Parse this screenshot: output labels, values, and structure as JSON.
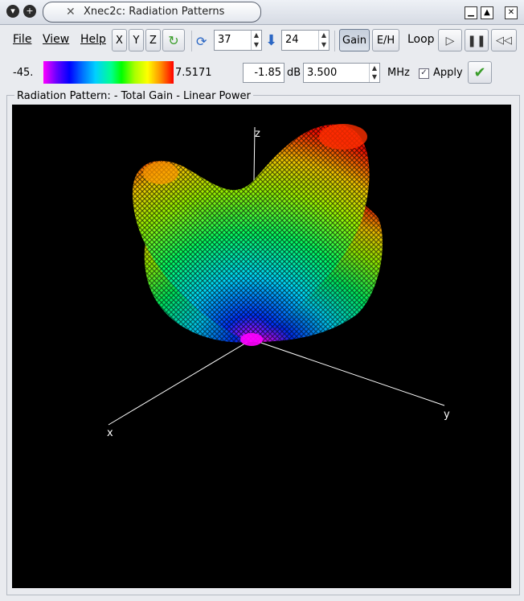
{
  "window": {
    "title": "Xnec2c: Radiation Patterns"
  },
  "menu": [
    "File",
    "View",
    "Help"
  ],
  "axis_buttons": [
    "X",
    "Y",
    "Z"
  ],
  "rotate": {
    "value": "37"
  },
  "incline": {
    "value": "24"
  },
  "mode_buttons": {
    "gain": "Gain",
    "eh": "E/H"
  },
  "loop": {
    "label": "Loop"
  },
  "scale": {
    "min": "-45.",
    "max": "7.5171"
  },
  "db_value": "-1.85",
  "db_unit": "dB",
  "frequency": {
    "value": "3.500",
    "unit": "MHz"
  },
  "apply": {
    "label": "Apply",
    "checked": true
  },
  "frame_label": "Radiation Pattern: - Total Gain - Linear Power",
  "axes": {
    "x": "x",
    "y": "y",
    "z": "z"
  },
  "colors": {
    "background": "#000000",
    "axis": "#ffffff"
  }
}
